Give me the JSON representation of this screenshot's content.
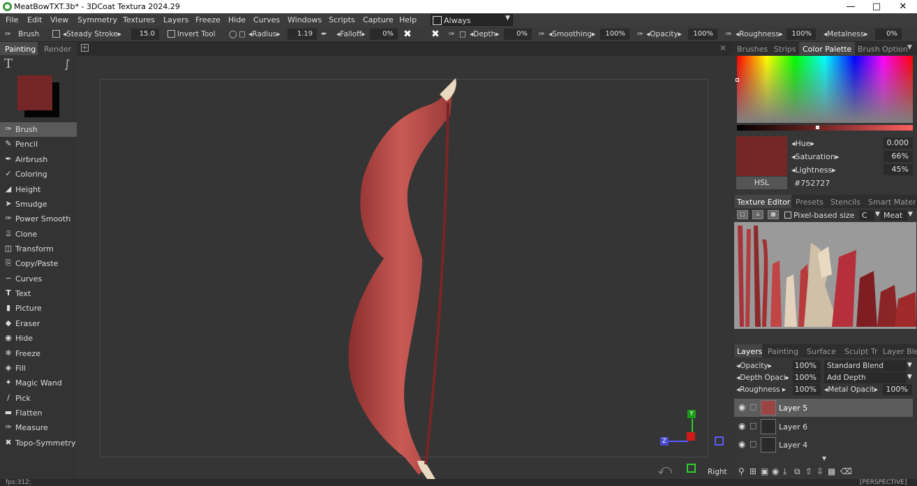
{
  "window": {
    "title": "MeatBowTXT.3b* - 3DCoat Textura 2024.29",
    "controls": [
      "—",
      "□",
      "✕"
    ]
  },
  "menu": [
    "File",
    "Edit",
    "View",
    "Symmetry",
    "Textures",
    "Layers",
    "Freeze",
    "Hide",
    "Curves",
    "Windows",
    "Scripts",
    "Capture",
    "Help"
  ],
  "always_label": "Always",
  "toolbar": {
    "brush": "Brush",
    "steady_stroke": "◂Steady  Stroke▸",
    "steady_value": "15.0",
    "invert_tool": "Invert  Tool",
    "radius": "◂Radius▸",
    "radius_value": "1.19",
    "falloff": "◂Falloff▸",
    "falloff_value": "0%",
    "depth": "◂Depth▸",
    "depth_value": "0%",
    "smoothing": "◂Smoothing▸",
    "smoothing_value": "100%",
    "opacity": "◂Opacity▸",
    "opacity_value": "100%",
    "roughness": "◂Roughness▸",
    "roughness_value": "100%",
    "metalness": "◂Metalness▸",
    "metalness_value": "0%"
  },
  "left_tabs": [
    "Painting",
    "Render"
  ],
  "primary_color": "#752727",
  "tools": [
    "Brush",
    "Pencil",
    "Airbrush",
    "Coloring",
    "Height",
    "Smudge",
    "Power  Smooth",
    "Clone",
    "Transform",
    "Copy/Paste",
    "Curves",
    "Text",
    "Picture",
    "Eraser",
    "Hide",
    "Freeze",
    "Fill",
    "Magic  Wand",
    "Pick",
    "Flatten",
    "Measure",
    "Topo-Symmetry"
  ],
  "viewport": {
    "axis_y": "Y",
    "axis_z": "Z",
    "view_name": "Right",
    "mode": "[PERSPECTIVE]"
  },
  "right_tabs_top": [
    "Brushes",
    "Strips",
    "Color Palette",
    "Brush",
    "Options"
  ],
  "hsl": {
    "hue_label": "◂Hue▸",
    "hue": "0.000",
    "sat_label": "◂Saturation▸",
    "sat": "66%",
    "light_label": "◂Lightness▸",
    "light": "45%",
    "mode": "HSL",
    "hex": "#752727"
  },
  "right_tabs_mid": [
    "Texture Editor",
    "Presets",
    "Stencils",
    "Smart Materi"
  ],
  "texture_editor": {
    "pixel_based": "Pixel-based size",
    "channel": "C",
    "material": "Meat"
  },
  "right_tabs_bottom": [
    "Layers",
    "Painting",
    "Surface",
    "Sculpt Tr",
    "Layer Ble"
  ],
  "layer_props": {
    "opacity": "◂Opacity▸",
    "opacity_val": "100%",
    "blend": "Standard Blend",
    "depth_op": "◂Depth  Opaci▸",
    "depth_op_val": "100%",
    "depth_mode": "Add Depth",
    "rough": "◂Roughness  ▸",
    "rough_val": "100%",
    "metal": "◂Metal  Opacit▸",
    "metal_val": "100%"
  },
  "layers": [
    "Layer  5",
    "Layer  6",
    "Layer  4"
  ],
  "status": {
    "fps": "fps:312;"
  }
}
